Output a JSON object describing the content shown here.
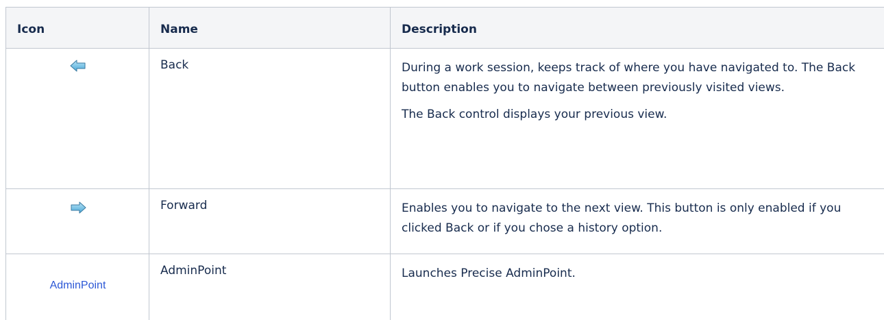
{
  "table": {
    "headers": {
      "icon": "Icon",
      "name": "Name",
      "description": "Description"
    },
    "rows": [
      {
        "icon": "back-arrow-icon",
        "name": "Back",
        "description": [
          "During a work session, keeps track of where you have navigated to. The Back button enables you to navigate between previously visited views.",
          "The Back control displays your previous view."
        ]
      },
      {
        "icon": "forward-arrow-icon",
        "name": "Forward",
        "description": [
          "Enables you to navigate to the next view. This button is only enabled if you clicked Back or if you chose a history option."
        ]
      },
      {
        "icon": "adminpoint-logo",
        "icon_text": "AdminPoint",
        "name": "AdminPoint",
        "description": [
          "Launches Precise AdminPoint."
        ]
      }
    ]
  },
  "colors": {
    "header_bg": "#f4f5f7",
    "border": "#c1c7d0",
    "text": "#172b4d",
    "arrow_fill": "#6fc1ea",
    "arrow_stroke": "#3a7aa0",
    "adminpoint_blue": "#2b57d6"
  }
}
